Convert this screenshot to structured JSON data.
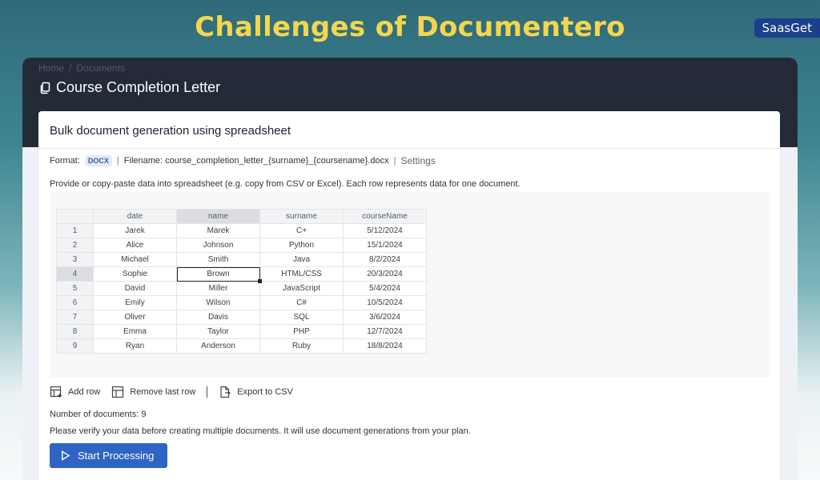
{
  "banner": {
    "title": "Challenges of Documentero",
    "brand": "SaasGet"
  },
  "breadcrumb": {
    "home": "Home",
    "sep": "/",
    "documents": "Documents"
  },
  "page": {
    "title": "Course Completion Letter"
  },
  "card": {
    "title": "Bulk document generation using spreadsheet",
    "format_label": "Format:",
    "format_value": "DOCX",
    "filename": "Filename: course_completion_letter_{surname}_{coursename}.docx",
    "settings": "Settings",
    "hint": "Provide or copy-paste data into spreadsheet (e.g. copy from CSV or Excel). Each row represents data for one document."
  },
  "sheet": {
    "columns": [
      "date",
      "name",
      "surname",
      "courseName"
    ],
    "rows": [
      [
        "1",
        "Jarek",
        "Marek",
        "C+",
        "5/12/2024"
      ],
      [
        "2",
        "Alice",
        "Johnson",
        "Python",
        "15/1/2024"
      ],
      [
        "3",
        "Michael",
        "Smith",
        "Java",
        "8/2/2024"
      ],
      [
        "4",
        "Sophie",
        "Brown",
        "HTML/CSS",
        "20/3/2024"
      ],
      [
        "5",
        "David",
        "Miller",
        "JavaScript",
        "5/4/2024"
      ],
      [
        "6",
        "Emily",
        "Wilson",
        "C#",
        "10/5/2024"
      ],
      [
        "7",
        "Oliver",
        "Davis",
        "SQL",
        "3/6/2024"
      ],
      [
        "8",
        "Emma",
        "Taylor",
        "PHP",
        "12/7/2024"
      ],
      [
        "9",
        "Ryan",
        "Anderson",
        "Ruby",
        "18/8/2024"
      ]
    ],
    "active_column": "name",
    "active_row": "4"
  },
  "actions": {
    "add_row": "Add row",
    "remove_row": "Remove last row",
    "export": "Export to CSV"
  },
  "footer": {
    "count": "Number of documents: 9",
    "warning": "Please verify your data before creating multiple documents. It will use document generations from your plan.",
    "start": "Start Processing"
  },
  "colors": {
    "banner_title": "#f4d64e",
    "header_bg": "#232b38",
    "button": "#2e64c4",
    "brand_badge": "#1b3f8a"
  }
}
